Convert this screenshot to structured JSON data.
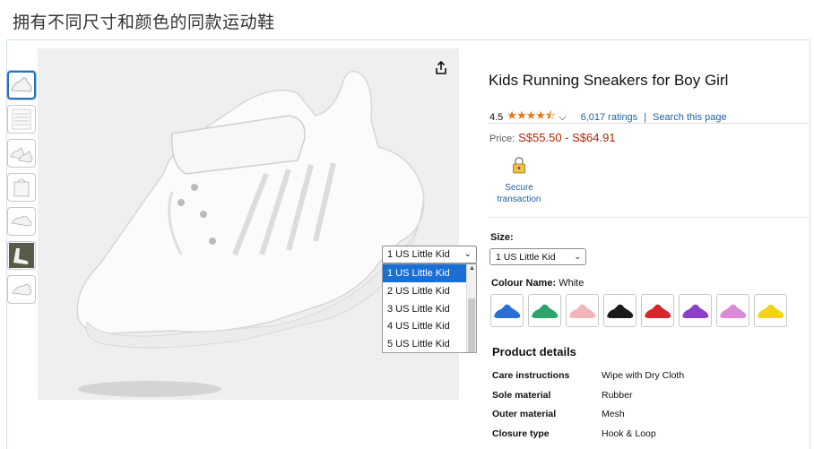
{
  "caption": "拥有不同尺寸和颜色的同款运动鞋",
  "product": {
    "title": "Kids Running Sneakers for Boy Girl",
    "rating_value": "4.5",
    "stars": "★★★★⯪",
    "rating_chevron": "⌵",
    "ratings_count": "6,017 ratings",
    "separator": "|",
    "search_link": "Search this page",
    "price_label": "Price:",
    "price_range": "S$55.50 - S$64.91",
    "secure_label": "Secure transaction"
  },
  "size_dropdown": {
    "selected": "1 US Little Kid",
    "options": [
      "1 US Little Kid",
      "2 US Little Kid",
      "3 US Little Kid",
      "4 US Little Kid",
      "5 US Little Kid"
    ]
  },
  "size": {
    "label": "Size:",
    "selected": "1 US Little Kid"
  },
  "colour": {
    "label": "Colour Name:",
    "value": "White",
    "swatches": [
      {
        "name": "blue",
        "color": "#2a6fd6"
      },
      {
        "name": "green",
        "color": "#2fa46a"
      },
      {
        "name": "pink",
        "color": "#f2b6b8"
      },
      {
        "name": "black",
        "color": "#1a1a1a"
      },
      {
        "name": "red",
        "color": "#d8262a"
      },
      {
        "name": "purple",
        "color": "#8a3fc8"
      },
      {
        "name": "light-purple",
        "color": "#d98ad9"
      },
      {
        "name": "yellow",
        "color": "#f4d21c"
      }
    ]
  },
  "product_details": {
    "title": "Product details",
    "rows": [
      {
        "key": "Care instructions",
        "value": "Wipe with Dry Cloth"
      },
      {
        "key": "Sole material",
        "value": "Rubber"
      },
      {
        "key": "Outer material",
        "value": "Mesh"
      },
      {
        "key": "Closure type",
        "value": "Hook & Loop"
      }
    ]
  },
  "thumbnails": [
    "shoe-side",
    "size-chart",
    "shoe-pair",
    "shoe-box",
    "shoe-sole",
    "shoe-on-foot",
    "shoe-top"
  ]
}
